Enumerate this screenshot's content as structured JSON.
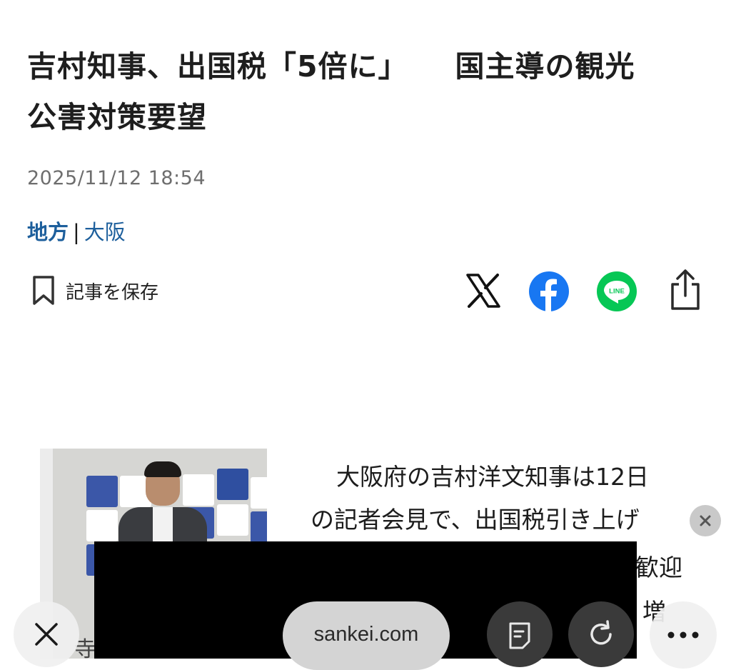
{
  "article": {
    "title_part1": "吉村知事、出国税「5倍に」",
    "title_part2": "国主導の観光",
    "title_line2": "公害対策要望",
    "date": "2025/11/12 18:54",
    "category_primary": "地方",
    "category_separator": "|",
    "category_secondary": "大阪",
    "save_label": "記事を保存",
    "body_line1": "大阪府の吉村洋文知事は12日",
    "body_line2": "の記者会見で、出国税引き上げ",
    "body_fragment_3": "歓迎",
    "body_fragment_4": "増",
    "image_left_fragment": "寺"
  },
  "share": {
    "icons": [
      "x-icon",
      "facebook-icon",
      "line-icon",
      "share-icon"
    ],
    "line_text": "LINE",
    "facebook_color": "#1877F2",
    "line_color": "#06C755"
  },
  "browser": {
    "url": "sankei.com"
  },
  "colors": {
    "accent": "#1d5f9c",
    "date": "#6e6e6e"
  }
}
